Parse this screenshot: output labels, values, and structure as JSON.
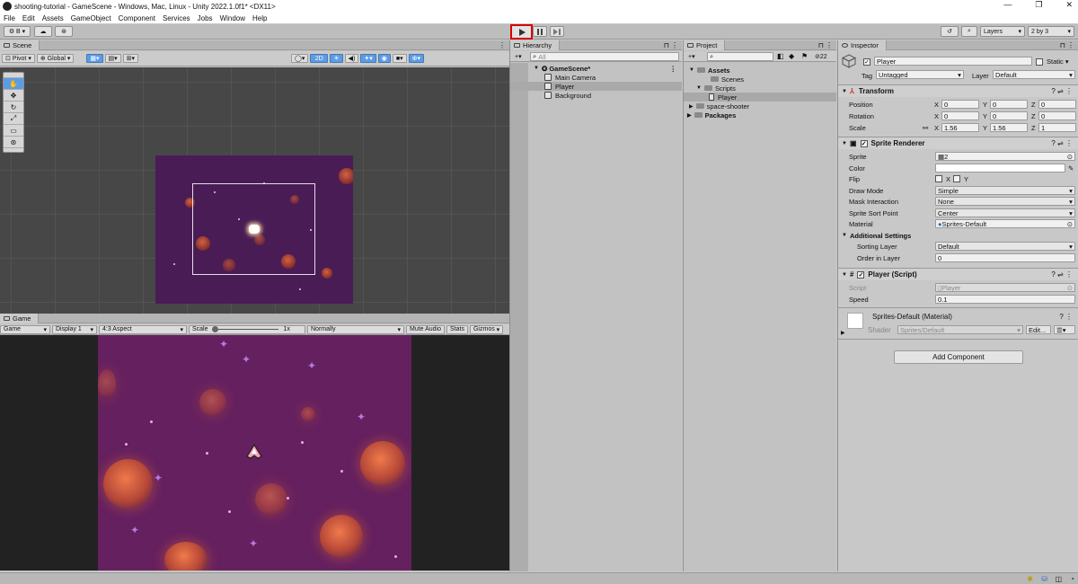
{
  "window": {
    "title": "shooting-tutorial - GameScene - Windows, Mac, Linux - Unity 2022.1.0f1* <DX11>",
    "minimize": "—",
    "restore": "❐",
    "close": "✕"
  },
  "menu": [
    "File",
    "Edit",
    "Assets",
    "GameObject",
    "Component",
    "Services",
    "Jobs",
    "Window",
    "Help"
  ],
  "toolbar": {
    "account_label": "B",
    "play_icon": "play-icon",
    "pause_icon": "pause-icon",
    "step_icon": "step-icon",
    "layers_label": "Layers",
    "layout_label": "2 by 3"
  },
  "scene": {
    "tab": "Scene",
    "pivot": "Pivot",
    "global": "Global",
    "mode_2d": "2D"
  },
  "game": {
    "tab": "Game",
    "view": "Game",
    "display": "Display 1",
    "aspect": "4:3 Aspect",
    "scale_label": "Scale",
    "scale_value": "1x",
    "play_mode": "Normally",
    "mute": "Mute Audio",
    "stats": "Stats",
    "gizmos": "Gizmos"
  },
  "hierarchy": {
    "tab": "Hierarchy",
    "search_placeholder": "All",
    "scene_name": "GameScene*",
    "items": [
      "Main Camera",
      "Player",
      "Background"
    ]
  },
  "project": {
    "tab": "Project",
    "count": "22",
    "tree": [
      {
        "label": "Assets",
        "bold": true
      },
      {
        "label": "Scenes"
      },
      {
        "label": "Scripts"
      },
      {
        "label": "Player"
      },
      {
        "label": "space-shooter"
      },
      {
        "label": "Packages",
        "bold": true
      }
    ]
  },
  "inspector": {
    "tab": "Inspector",
    "object_name": "Player",
    "static_label": "Static",
    "tag_label": "Tag",
    "tag_value": "Untagged",
    "layer_label": "Layer",
    "layer_value": "Default",
    "transform": {
      "title": "Transform",
      "position": {
        "label": "Position",
        "x": "0",
        "y": "0",
        "z": "0"
      },
      "rotation": {
        "label": "Rotation",
        "x": "0",
        "y": "0",
        "z": "0"
      },
      "scale": {
        "label": "Scale",
        "x": "1.56",
        "y": "1.56",
        "z": "1"
      }
    },
    "sprite_renderer": {
      "title": "Sprite Renderer",
      "sprite_label": "Sprite",
      "sprite_value": "2",
      "color_label": "Color",
      "flip_label": "Flip",
      "flip_x": "X",
      "flip_y": "Y",
      "draw_mode_label": "Draw Mode",
      "draw_mode_value": "Simple",
      "mask_label": "Mask Interaction",
      "mask_value": "None",
      "sort_point_label": "Sprite Sort Point",
      "sort_point_value": "Center",
      "material_label": "Material",
      "material_value": "Sprites-Default",
      "additional": "Additional Settings",
      "sorting_layer_label": "Sorting Layer",
      "sorting_layer_value": "Default",
      "order_label": "Order in Layer",
      "order_value": "0"
    },
    "player_script": {
      "title": "Player (Script)",
      "script_label": "Script",
      "script_value": "Player",
      "speed_label": "Speed",
      "speed_value": "0.1"
    },
    "material": {
      "title": "Sprites-Default (Material)",
      "shader_label": "Shader",
      "shader_value": "Sprites/Default",
      "edit_label": "Edit..."
    },
    "add_component": "Add Component"
  },
  "colors": {
    "accent": "#d40000",
    "selection": "#5b9ce6",
    "background": "#65205f"
  }
}
